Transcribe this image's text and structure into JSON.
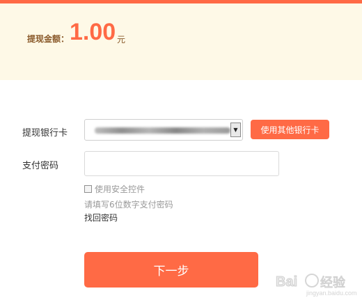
{
  "summary": {
    "amount_label": "提现金额：",
    "amount_value": "1.00",
    "amount_unit": "元"
  },
  "form": {
    "bank_card_label": "提现银行卡",
    "bank_select_arrow": "▼",
    "other_bank_button": "使用其他银行卡",
    "password_label": "支付密码",
    "password_value": "",
    "security_control_label": "使用安全控件",
    "password_hint": "请填写6位数字支付密码",
    "forgot_password": "找回密码",
    "next_button": "下一步"
  },
  "watermark": {
    "logo": "Bai",
    "name": "经验",
    "url": "jingyan.baidu.com"
  },
  "colors": {
    "accent": "#ff6a45",
    "summary_bg": "#fef9e7",
    "label_brown": "#8a5a2b"
  }
}
